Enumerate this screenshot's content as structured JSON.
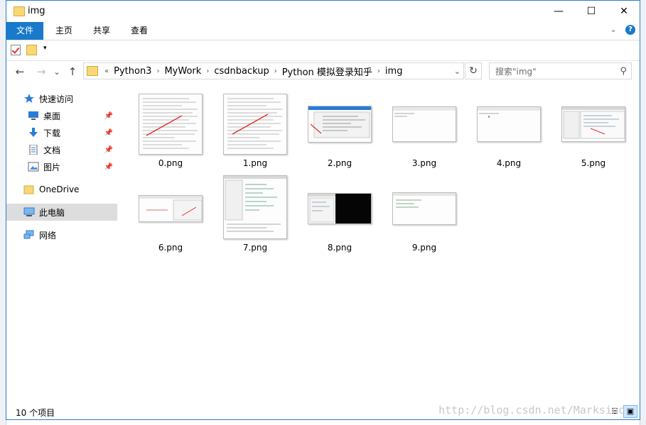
{
  "window": {
    "title": "img",
    "controls": {
      "minimize": "—",
      "maximize": "☐",
      "close": "✕"
    }
  },
  "ribbon": {
    "tabs": [
      {
        "label": "文件",
        "active": true
      },
      {
        "label": "主页"
      },
      {
        "label": "共享"
      },
      {
        "label": "查看"
      }
    ],
    "expand_icon": "chevron-down-icon",
    "help_icon": "help-icon"
  },
  "quick_access": {
    "dropdown": "▾"
  },
  "navigation": {
    "back": "←",
    "forward": "→",
    "recent": "⌄",
    "up": "↑",
    "breadcrumb_prefix": "«",
    "breadcrumb": [
      "Python3",
      "MyWork",
      "csdnbackup",
      "Python 模拟登录知乎",
      "img"
    ],
    "refresh": "↻"
  },
  "search": {
    "placeholder": "搜索\"img\""
  },
  "sidebar": {
    "items": [
      {
        "label": "快速访问",
        "icon": "star-icon"
      },
      {
        "label": "桌面",
        "icon": "desktop-icon",
        "pinned": true
      },
      {
        "label": "下载",
        "icon": "download-icon",
        "pinned": true
      },
      {
        "label": "文档",
        "icon": "document-icon",
        "pinned": true
      },
      {
        "label": "图片",
        "icon": "pictures-icon",
        "pinned": true
      },
      {
        "label": "OneDrive",
        "icon": "onedrive-icon"
      },
      {
        "label": "此电脑",
        "icon": "this-pc-icon",
        "selected": true
      },
      {
        "label": "网络",
        "icon": "network-icon"
      }
    ]
  },
  "files": [
    {
      "name": "0.png",
      "preview": "text-page"
    },
    {
      "name": "1.png",
      "preview": "text-page"
    },
    {
      "name": "2.png",
      "preview": "ide-screenshot"
    },
    {
      "name": "3.png",
      "preview": "blank-window"
    },
    {
      "name": "4.png",
      "preview": "blank-window"
    },
    {
      "name": "5.png",
      "preview": "ide-screenshot"
    },
    {
      "name": "6.png",
      "preview": "browser-screenshot"
    },
    {
      "name": "7.png",
      "preview": "code-page"
    },
    {
      "name": "8.png",
      "preview": "console-screenshot"
    },
    {
      "name": "9.png",
      "preview": "blank-window"
    }
  ],
  "status": {
    "count_text": "10 个项目",
    "watermark": "http://blog.csdn.net/Marksinc"
  }
}
